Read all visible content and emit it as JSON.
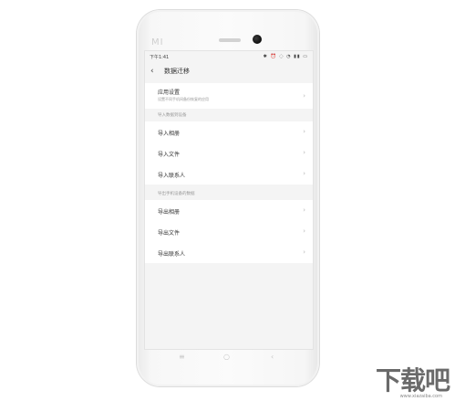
{
  "phone": {
    "brand": "MI"
  },
  "statusbar": {
    "time": "下午1:41",
    "icons": "✱ ⏰ ◌ ◔ ▮▮ ▭"
  },
  "titlebar": {
    "back": "‹",
    "title": "数据迁移"
  },
  "app_settings": {
    "label": "应用设置",
    "sublabel": "设置不同手机间备份恢复的应用"
  },
  "import_section": {
    "header": "导入数据到设备",
    "items": [
      {
        "label": "导入相册"
      },
      {
        "label": "导入文件"
      },
      {
        "label": "导入联系人"
      }
    ]
  },
  "export_section": {
    "header": "导出手机设备的数据",
    "items": [
      {
        "label": "导出相册"
      },
      {
        "label": "导出文件"
      },
      {
        "label": "导出联系人"
      }
    ]
  },
  "chevron": "›",
  "navbar": {
    "menu": "≡",
    "home": "○",
    "back": "‹"
  },
  "watermark": {
    "text": "下载吧",
    "sub": "www.xiazaiba.com"
  }
}
